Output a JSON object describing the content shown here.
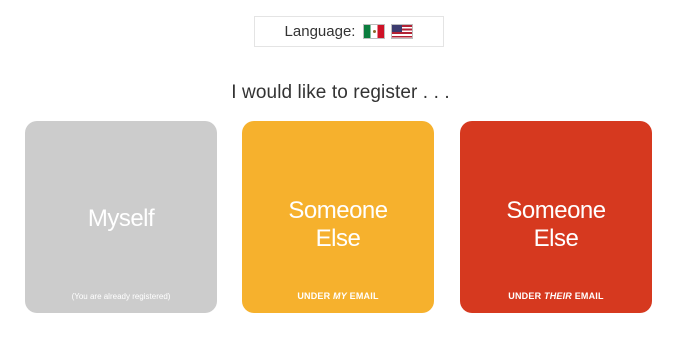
{
  "language_selector": {
    "label": "Language:",
    "flags": [
      {
        "name": "Mexico",
        "icon": "mexico-flag-icon"
      },
      {
        "name": "United States",
        "icon": "us-flag-icon"
      }
    ]
  },
  "heading": "I would like to register . . .",
  "options": {
    "myself": {
      "title": "Myself",
      "subtitle": "(You are already registered)",
      "color": "#cccccc"
    },
    "someone_else_my_email": {
      "title_line1": "Someone",
      "title_line2": "Else",
      "subtitle_prefix": "UNDER",
      "subtitle_emphasis": "MY",
      "subtitle_suffix": "EMAIL",
      "color": "#f6b12d"
    },
    "someone_else_their_email": {
      "title_line1": "Someone",
      "title_line2": "Else",
      "subtitle_prefix": "UNDER",
      "subtitle_emphasis": "THEIR",
      "subtitle_suffix": "EMAIL",
      "color": "#d6391f"
    }
  }
}
